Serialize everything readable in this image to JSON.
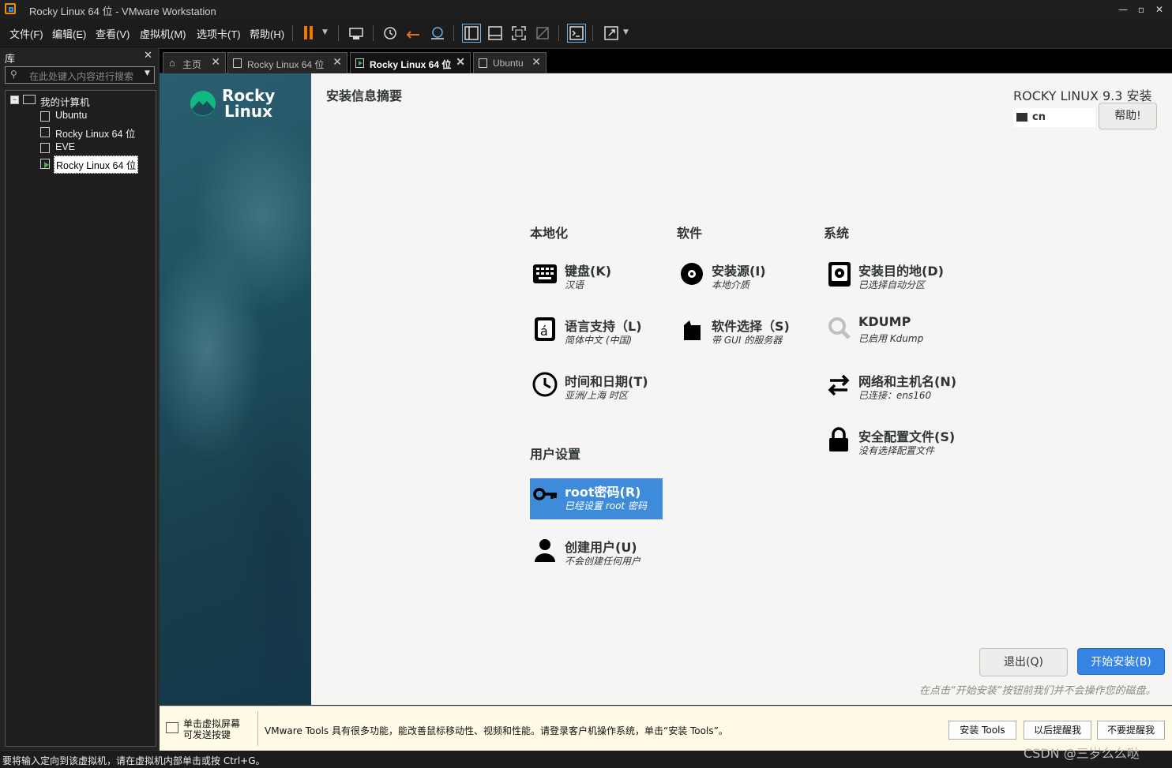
{
  "window": {
    "title": "Rocky Linux 64 位 - VMware Workstation"
  },
  "menu": [
    "文件(F)",
    "编辑(E)",
    "查看(V)",
    "虚拟机(M)",
    "选项卡(T)",
    "帮助(H)"
  ],
  "library": {
    "title": "库",
    "search_placeholder": "在此处键入内容进行搜索",
    "root": "我的计算机",
    "items": [
      "Ubuntu",
      "Rocky Linux 64 位",
      "EVE",
      "Rocky Linux 64 位"
    ]
  },
  "tabs": [
    "主页",
    "Rocky Linux 64 位",
    "Rocky Linux 64 位",
    "Ubuntu"
  ],
  "installer": {
    "brand_line1": "Rocky",
    "brand_line2": "Linux",
    "page_title": "安装信息摘要",
    "product": "ROCKY LINUX 9.3 安装",
    "keyboard_layout": "cn",
    "help_button": "帮助!",
    "sections": {
      "localization": "本地化",
      "software": "软件",
      "system": "系统",
      "user": "用户设置"
    },
    "spokes": {
      "keyboard": {
        "title": "键盘(K)",
        "status": "汉语"
      },
      "language": {
        "title": "语言支持（L)",
        "status": "简体中文 (中国)"
      },
      "time": {
        "title": "时间和日期(T)",
        "status": "亚洲/上海 时区"
      },
      "source": {
        "title": "安装源(I)",
        "status": "本地介质"
      },
      "software": {
        "title": "软件选择（S)",
        "status": "带 GUI 的服务器"
      },
      "destination": {
        "title": "安装目的地(D)",
        "status": "已选择自动分区"
      },
      "kdump": {
        "title": "KDUMP",
        "status": "已启用 Kdump"
      },
      "network": {
        "title": "网络和主机名(N)",
        "status": "已连接：ens160"
      },
      "security": {
        "title": "安全配置文件(S)",
        "status": "没有选择配置文件"
      },
      "root": {
        "title": "root密码(R)",
        "status": "已经设置 root 密码"
      },
      "user": {
        "title": "创建用户(U)",
        "status": "不会创建任何用户"
      }
    },
    "quit_button": "退出(Q)",
    "begin_button": "开始安装(B)",
    "footer_note": "在点击“开始安装”按钮前我们并不会操作您的磁盘。"
  },
  "tools_bar": {
    "hint_line1": "单击虚拟屏幕",
    "hint_line2": "可发送按键",
    "message": "VMware Tools 具有很多功能，能改善鼠标移动性、视频和性能。请登录客户机操作系统，单击“安装 Tools”。",
    "install": "安装 Tools",
    "later": "以后提醒我",
    "never": "不要提醒我"
  },
  "status_bar": "要将输入定向到该虚拟机，请在虚拟机内部单击或按 Ctrl+G。",
  "watermark": "CSDN @三岁么么哒",
  "colors": {
    "accent": "#3584e4",
    "rocky_green": "#10b981",
    "selected_spoke": "#3d8bd9"
  }
}
